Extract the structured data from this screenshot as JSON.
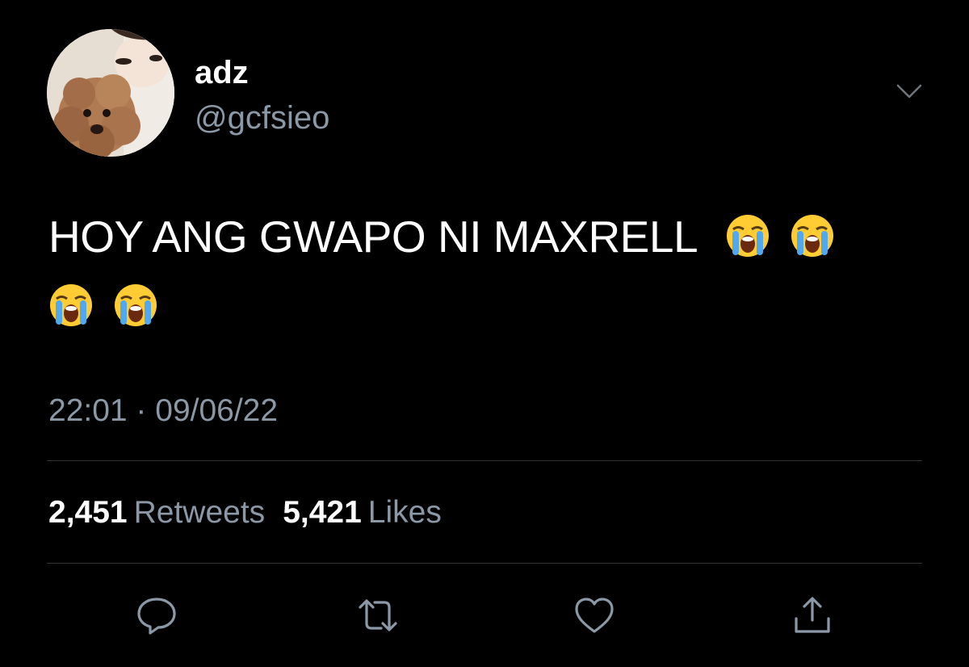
{
  "user": {
    "display_name": "adz",
    "handle": "@gcfsieo"
  },
  "tweet": {
    "text": "HOY ANG GWAPO NI MAXRELL",
    "emoji_icons": [
      "loudly-crying-face-icon",
      "loudly-crying-face-icon",
      "loudly-crying-face-icon",
      "loudly-crying-face-icon"
    ],
    "timestamp": "22:01 · 09/06/22"
  },
  "stats": {
    "retweets_count": "2,451",
    "retweets_label": "Retweets",
    "likes_count": "5,421",
    "likes_label": "Likes"
  },
  "actions": {
    "reply_icon": "reply-icon",
    "retweet_icon": "retweet-icon",
    "like_icon": "heart-icon",
    "share_icon": "share-icon"
  },
  "theme": {
    "background": "#000000",
    "primary_text": "#ffffff",
    "secondary_text": "#8b98a5",
    "divider": "#2f3336",
    "icon_color": "#8b98a5"
  }
}
